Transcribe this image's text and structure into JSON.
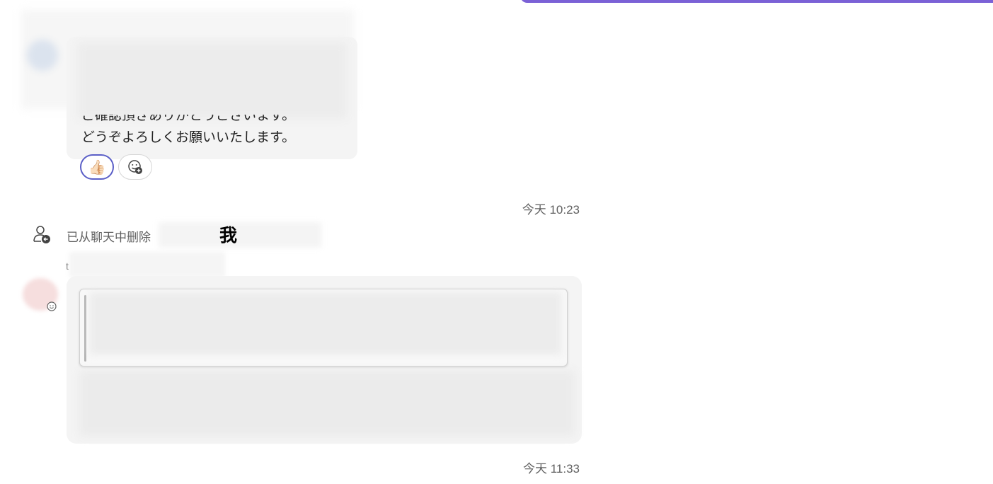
{
  "message1": {
    "line1": "ご確認頂きありがとうございます。",
    "line2": "どうぞよろしくお願いいたします。",
    "reactions": [
      {
        "emoji": "👍🏻",
        "icon": "thumbs-up-icon",
        "selected": true
      },
      {
        "emoji": "",
        "icon": "add-reaction-icon",
        "selected": false
      }
    ]
  },
  "timestamp1": "今天 10:23",
  "system_event": {
    "text": "已从聊天中删除",
    "me": "我",
    "icon": "person-remove-icon"
  },
  "timestamp2": "今天 11:33",
  "message2": {
    "sender_fragment": "t"
  },
  "colors": {
    "accent": "#7b61d6",
    "reaction_selected_border": "#5b5fc7",
    "bubble": "#f4f4f4"
  }
}
